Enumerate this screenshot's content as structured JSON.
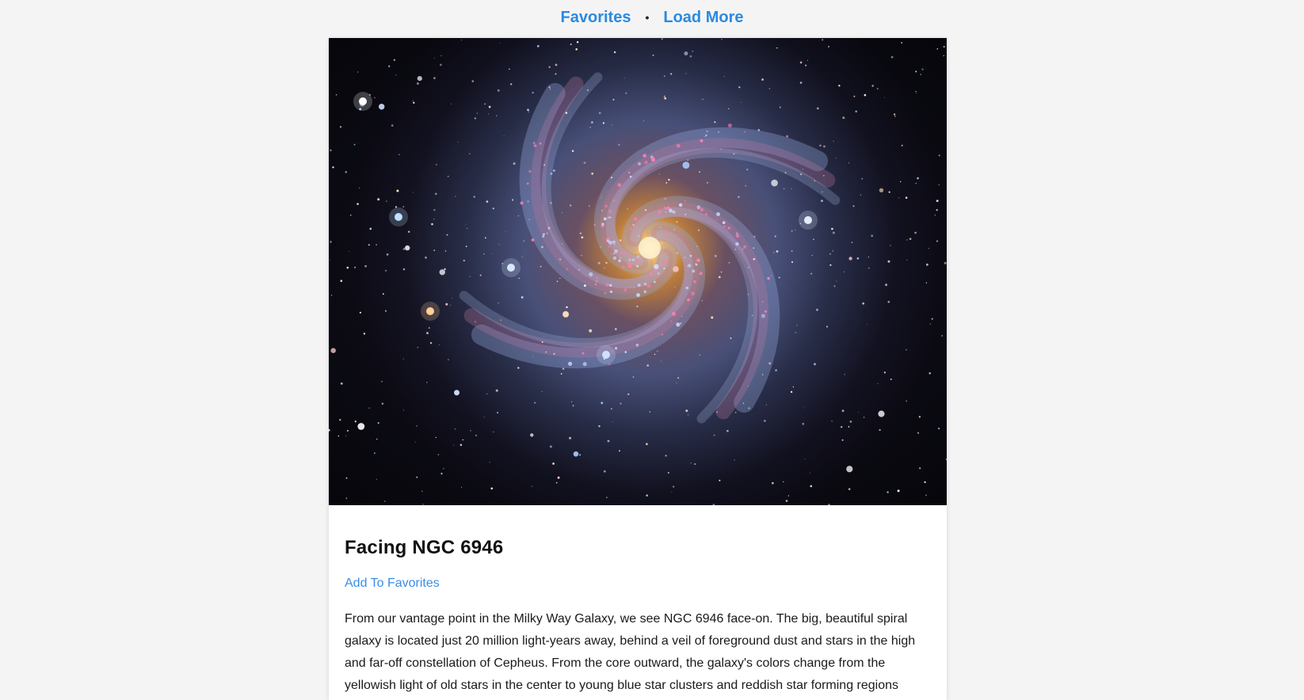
{
  "nav": {
    "favorites_label": "Favorites",
    "separator": "•",
    "load_more_label": "Load More"
  },
  "post": {
    "title": "Facing NGC 6946",
    "add_favorite_label": "Add To Favorites",
    "description": "From our vantage point in the Milky Way Galaxy, we see NGC 6946 face-on. The big, beautiful spiral galaxy is located just 20 million light-years away, behind a veil of foreground dust and stars in the high and far-off constellation of Cepheus. From the core outward, the galaxy's colors change from the yellowish light of old stars in the center to young blue star clusters and reddish star forming regions"
  },
  "colors": {
    "link": "#2a8ae0",
    "page_background": "#f4f4f4",
    "card_background": "#ffffff"
  }
}
